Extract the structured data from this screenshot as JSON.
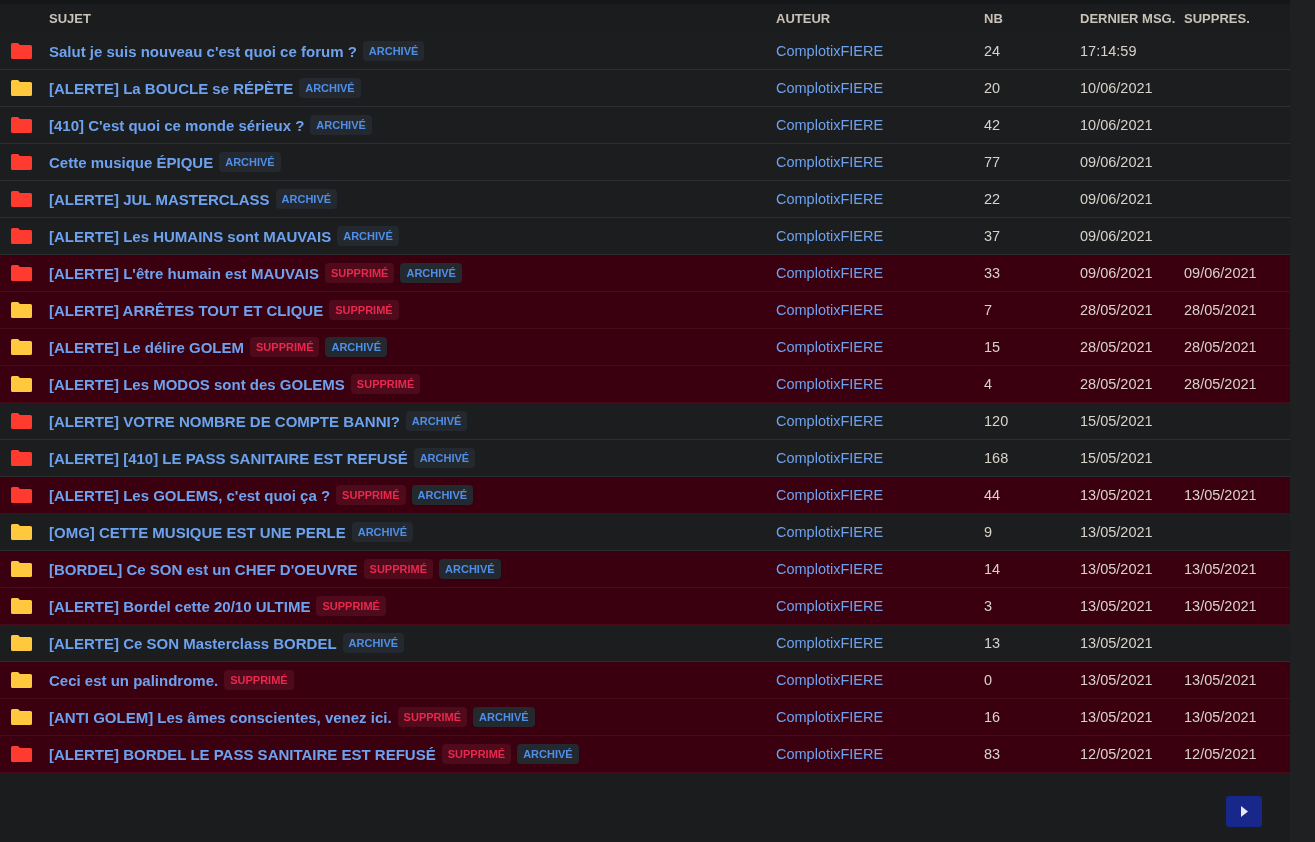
{
  "table": {
    "columns": [
      "SUJET",
      "AUTEUR",
      "NB",
      "DERNIER MSG.",
      "SUPPRES."
    ],
    "rows": [
      {
        "color": "#ff3b2f",
        "subject": "Salut je suis nouveau c'est quoi ce forum ?",
        "tags": [
          {
            "kind": "archived",
            "label": "ARCHIVÉ"
          }
        ],
        "author": "ComplotixFIERE",
        "count": "24",
        "last": "17:14:59",
        "deleted": false
      },
      {
        "color": "#ffc83d",
        "subject": "[ALERTE] La BOUCLE se RÉPÈTE",
        "tags": [
          {
            "kind": "archived",
            "label": "ARCHIVÉ"
          }
        ],
        "author": "ComplotixFIERE",
        "count": "20",
        "last": "10/06/2021",
        "deleted": false
      },
      {
        "color": "#ff3b2f",
        "subject": "[410] C'est quoi ce monde sérieux ?",
        "tags": [
          {
            "kind": "archived",
            "label": "ARCHIVÉ"
          }
        ],
        "author": "ComplotixFIERE",
        "count": "42",
        "last": "10/06/2021",
        "deleted": false
      },
      {
        "color": "#ff3b2f",
        "subject": "Cette musique ÉPIQUE",
        "tags": [
          {
            "kind": "archived",
            "label": "ARCHIVÉ"
          }
        ],
        "author": "ComplotixFIERE",
        "count": "77",
        "last": "09/06/2021",
        "deleted": false
      },
      {
        "color": "#ff3b2f",
        "subject": "[ALERTE] JUL MASTERCLASS",
        "tags": [
          {
            "kind": "archived",
            "label": "ARCHIVÉ"
          }
        ],
        "author": "ComplotixFIERE",
        "count": "22",
        "last": "09/06/2021",
        "deleted": false
      },
      {
        "color": "#ff3b2f",
        "subject": "[ALERTE] Les HUMAINS sont MAUVAIS",
        "tags": [
          {
            "kind": "archived",
            "label": "ARCHIVÉ"
          }
        ],
        "author": "ComplotixFIERE",
        "count": "37",
        "last": "09/06/2021",
        "deleted": false
      },
      {
        "color": "#ff3b2f",
        "subject": "[ALERTE] L'être humain est MAUVAIS",
        "tags": [
          {
            "kind": "deleted",
            "label": "SUPPRIMÉ"
          },
          {
            "kind": "archived",
            "label": "ARCHIVÉ"
          }
        ],
        "author": "ComplotixFIERE",
        "count": "33",
        "last": "09/06/2021",
        "deleted": true,
        "deleted_on": "09/06/2021"
      },
      {
        "color": "#ffc83d",
        "subject": "[ALERTE] ARRÊTES TOUT ET CLIQUE",
        "tags": [
          {
            "kind": "deleted",
            "label": "SUPPRIMÉ"
          }
        ],
        "author": "ComplotixFIERE",
        "count": "7",
        "last": "28/05/2021",
        "deleted": true,
        "deleted_on": "28/05/2021"
      },
      {
        "color": "#ffc83d",
        "subject": "[ALERTE] Le délire GOLEM",
        "tags": [
          {
            "kind": "deleted",
            "label": "SUPPRIMÉ"
          },
          {
            "kind": "archived",
            "label": "ARCHIVÉ"
          }
        ],
        "author": "ComplotixFIERE",
        "count": "15",
        "last": "28/05/2021",
        "deleted": true,
        "deleted_on": "28/05/2021"
      },
      {
        "color": "#ffc83d",
        "subject": "[ALERTE] Les MODOS sont des GOLEMS",
        "tags": [
          {
            "kind": "deleted",
            "label": "SUPPRIMÉ"
          }
        ],
        "author": "ComplotixFIERE",
        "count": "4",
        "last": "28/05/2021",
        "deleted": true,
        "deleted_on": "28/05/2021"
      },
      {
        "color": "#ff3b2f",
        "subject": "[ALERTE] VOTRE NOMBRE DE COMPTE BANNI?",
        "tags": [
          {
            "kind": "archived",
            "label": "ARCHIVÉ"
          }
        ],
        "author": "ComplotixFIERE",
        "count": "120",
        "last": "15/05/2021",
        "deleted": false
      },
      {
        "color": "#ff3b2f",
        "subject": "[ALERTE] [410] LE PASS SANITAIRE EST REFUSÉ",
        "tags": [
          {
            "kind": "archived",
            "label": "ARCHIVÉ"
          }
        ],
        "author": "ComplotixFIERE",
        "count": "168",
        "last": "15/05/2021",
        "deleted": false
      },
      {
        "color": "#ff3b2f",
        "subject": "[ALERTE] Les GOLEMS, c'est quoi ça ?",
        "tags": [
          {
            "kind": "deleted",
            "label": "SUPPRIMÉ"
          },
          {
            "kind": "archived",
            "label": "ARCHIVÉ"
          }
        ],
        "author": "ComplotixFIERE",
        "count": "44",
        "last": "13/05/2021",
        "deleted": true,
        "deleted_on": "13/05/2021"
      },
      {
        "color": "#ffc83d",
        "subject": "[OMG] CETTE MUSIQUE EST UNE PERLE",
        "tags": [
          {
            "kind": "archived",
            "label": "ARCHIVÉ"
          }
        ],
        "author": "ComplotixFIERE",
        "count": "9",
        "last": "13/05/2021",
        "deleted": false
      },
      {
        "color": "#ffc83d",
        "subject": "[BORDEL] Ce SON est un CHEF D'OEUVRE",
        "tags": [
          {
            "kind": "deleted",
            "label": "SUPPRIMÉ"
          },
          {
            "kind": "archived",
            "label": "ARCHIVÉ"
          }
        ],
        "author": "ComplotixFIERE",
        "count": "14",
        "last": "13/05/2021",
        "deleted": true,
        "deleted_on": "13/05/2021"
      },
      {
        "color": "#ffc83d",
        "subject": "[ALERTE] Bordel cette 20/10 ULTIME",
        "tags": [
          {
            "kind": "deleted",
            "label": "SUPPRIMÉ"
          }
        ],
        "author": "ComplotixFIERE",
        "count": "3",
        "last": "13/05/2021",
        "deleted": true,
        "deleted_on": "13/05/2021"
      },
      {
        "color": "#ffc83d",
        "subject": "[ALERTE] Ce SON Masterclass BORDEL",
        "tags": [
          {
            "kind": "archived",
            "label": "ARCHIVÉ"
          }
        ],
        "author": "ComplotixFIERE",
        "count": "13",
        "last": "13/05/2021",
        "deleted": false
      },
      {
        "color": "#ffc83d",
        "subject": "Ceci est un palindrome.",
        "tags": [
          {
            "kind": "deleted",
            "label": "SUPPRIMÉ"
          }
        ],
        "author": "ComplotixFIERE",
        "count": "0",
        "last": "13/05/2021",
        "deleted": true,
        "deleted_on": "13/05/2021"
      },
      {
        "color": "#ffc83d",
        "subject": "[ANTI GOLEM] Les âmes conscientes, venez ici.",
        "tags": [
          {
            "kind": "deleted",
            "label": "SUPPRIMÉ"
          },
          {
            "kind": "archived",
            "label": "ARCHIVÉ"
          }
        ],
        "author": "ComplotixFIERE",
        "count": "16",
        "last": "13/05/2021",
        "deleted": true,
        "deleted_on": "13/05/2021"
      },
      {
        "color": "#ff3b2f",
        "subject": "[ALERTE] BORDEL LE PASS SANITAIRE EST REFUSÉ",
        "tags": [
          {
            "kind": "deleted",
            "label": "SUPPRIMÉ"
          },
          {
            "kind": "archived",
            "label": "ARCHIVÉ"
          }
        ],
        "author": "ComplotixFIERE",
        "count": "83",
        "last": "12/05/2021",
        "deleted": true,
        "deleted_on": "12/05/2021"
      }
    ]
  }
}
